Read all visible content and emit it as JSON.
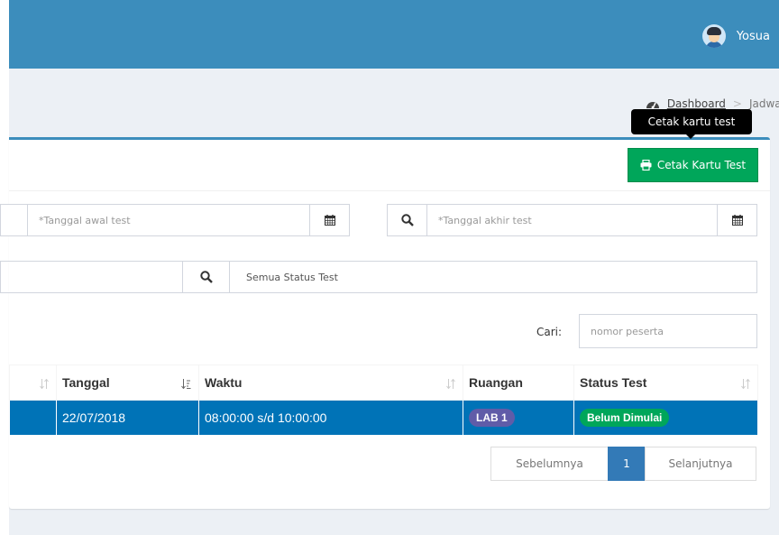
{
  "header": {
    "user_name": "Yosua"
  },
  "breadcrumb": {
    "home": "Dashboard",
    "separator": ">",
    "current": "Jadwal"
  },
  "tooltip": "Cetak kartu test",
  "toolbar": {
    "print_label": "Cetak Kartu Test"
  },
  "filters": {
    "start_date_placeholder": "*Tanggal awal test",
    "end_date_placeholder": "*Tanggal akhir test",
    "status_select": "Semua Status Test"
  },
  "search": {
    "label": "Cari:",
    "placeholder": "nomor peserta"
  },
  "table": {
    "columns": [
      "Tanggal",
      "Waktu",
      "Ruangan",
      "Status Test"
    ],
    "rows": [
      {
        "tanggal": "22/07/2018",
        "waktu": "08:00:00 s/d 10:00:00",
        "ruangan": "LAB 1",
        "status": "Belum Dimulai"
      }
    ]
  },
  "pagination": {
    "prev": "Sebelumnya",
    "page": "1",
    "next": "Selanjutnya"
  },
  "colors": {
    "topbar": "#3c8dbc",
    "selected_row": "#0073b7",
    "success": "#00a65a",
    "badge_purple": "#605ca8"
  },
  "icons": [
    "user-avatar-icon",
    "dashboard-icon",
    "print-icon",
    "calendar-icon",
    "search-icon",
    "sort-icon",
    "caret-down-icon"
  ]
}
